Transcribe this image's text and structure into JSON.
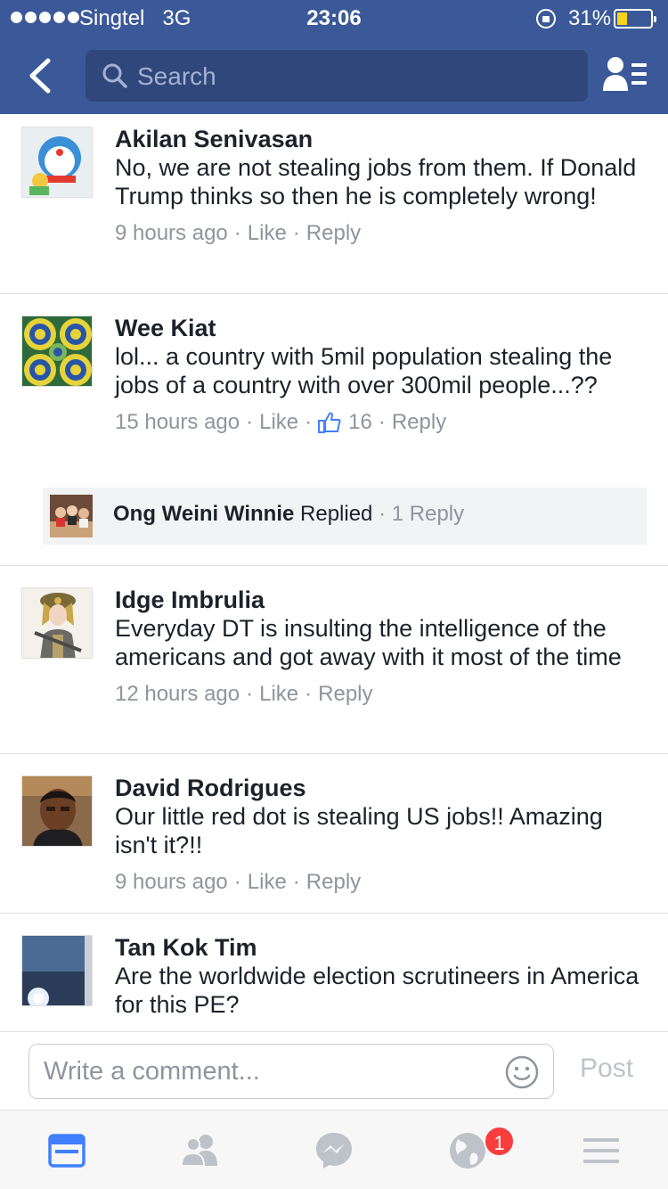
{
  "status_bar": {
    "carrier": "Singtel",
    "network": "3G",
    "time": "23:06",
    "battery_percent": "31%",
    "battery_level": 0.31,
    "battery_color": "#f8d21b"
  },
  "header": {
    "background": "#3b5998",
    "back_icon": "chevron-left-icon",
    "search_placeholder": "Search",
    "friends_icon": "friends-list-icon"
  },
  "comments": [
    {
      "name": "Akilan Senivasan",
      "text": "No, we are not stealing jobs from them. If Donald Trump thinks so then he is completely wrong!",
      "time": "9 hours ago",
      "like_label": "Like",
      "reply_label": "Reply"
    },
    {
      "name": "Wee Kiat",
      "text": "lol... a country with 5mil population stealing the jobs of a country with over 300mil people...??",
      "time": "15 hours ago",
      "like_label": "Like",
      "like_count": "16",
      "reply_label": "Reply",
      "reply_summary": {
        "name": "Ong Weini Winnie",
        "action": "Replied",
        "count": "1 Reply"
      }
    },
    {
      "name": "Idge Imbrulia",
      "text": "Everyday DT is insulting the intelligence of the americans and got away with it most of the time",
      "time": "12 hours ago",
      "like_label": "Like",
      "reply_label": "Reply"
    },
    {
      "name": "David Rodrigues",
      "text": "Our little red dot is stealing US jobs!! Amazing isn't it?!!",
      "time": "9 hours ago",
      "like_label": "Like",
      "reply_label": "Reply"
    },
    {
      "name": "Tan Kok Tim",
      "text": "Are the worldwide election scrutineers in America for this PE?"
    }
  ],
  "composer": {
    "placeholder": "Write a comment...",
    "post_label": "Post",
    "emoji_icon": "smiley-icon"
  },
  "tab_bar": {
    "tabs": [
      "news-feed-icon",
      "friends-icon",
      "messenger-icon",
      "notifications-globe-icon",
      "menu-icon"
    ],
    "active_color": "#4080ff",
    "inactive_color": "#bec3c9",
    "notification_badge": "1"
  }
}
